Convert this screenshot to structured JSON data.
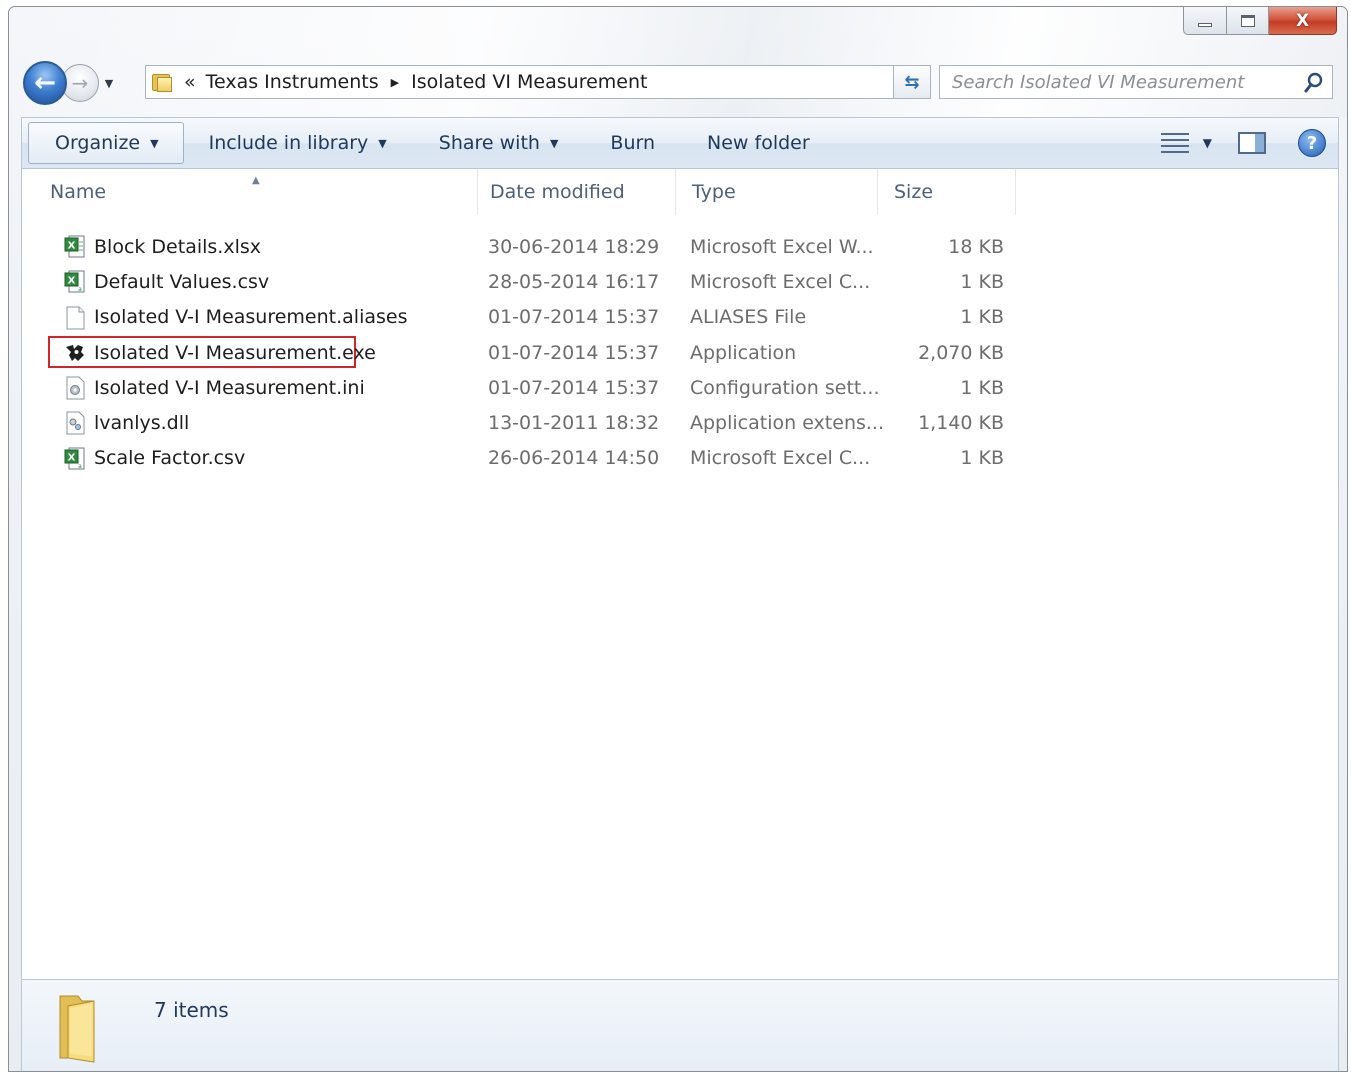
{
  "window": {
    "caption": {
      "minimize": "minimize",
      "maximize": "maximize",
      "close_glyph": "X"
    }
  },
  "navigation": {
    "back_icon": "back-arrow-icon",
    "forward_icon": "forward-arrow-icon",
    "breadcrumb_prefix": "«",
    "breadcrumb": [
      "Texas Instruments",
      "Isolated VI Measurement"
    ],
    "search_placeholder": "Search Isolated VI Measurement"
  },
  "toolbar": {
    "organize": "Organize",
    "include_in_library": "Include in library",
    "share_with": "Share with",
    "burn": "Burn",
    "new_folder": "New folder"
  },
  "columns": {
    "name": "Name",
    "date_modified": "Date modified",
    "type": "Type",
    "size": "Size"
  },
  "files": [
    {
      "name": "Block Details.xlsx",
      "date": "30-06-2014 18:29",
      "type": "Microsoft Excel W...",
      "size": "18 KB",
      "icon": "excel-file-icon"
    },
    {
      "name": "Default Values.csv",
      "date": "28-05-2014 16:17",
      "type": "Microsoft Excel C...",
      "size": "1 KB",
      "icon": "csv-file-icon"
    },
    {
      "name": "Isolated V-I Measurement.aliases",
      "date": "01-07-2014 15:37",
      "type": "ALIASES File",
      "size": "1 KB",
      "icon": "blank-file-icon"
    },
    {
      "name": "Isolated V-I Measurement.exe",
      "date": "01-07-2014 15:37",
      "type": "Application",
      "size": "2,070 KB",
      "icon": "texas-instruments-app-icon",
      "highlighted": true
    },
    {
      "name": "Isolated V-I Measurement.ini",
      "date": "01-07-2014 15:37",
      "type": "Configuration sett...",
      "size": "1 KB",
      "icon": "config-file-icon"
    },
    {
      "name": "lvanlys.dll",
      "date": "13-01-2011 18:32",
      "type": "Application extens...",
      "size": "1,140 KB",
      "icon": "dll-file-icon"
    },
    {
      "name": "Scale Factor.csv",
      "date": "26-06-2014 14:50",
      "type": "Microsoft Excel C...",
      "size": "1 KB",
      "icon": "csv-file-icon"
    }
  ],
  "details": {
    "items_count": "7 items"
  },
  "colors": {
    "highlight_border": "#d2252b",
    "command_text": "#1e395b",
    "close_button": "#c43c24"
  }
}
